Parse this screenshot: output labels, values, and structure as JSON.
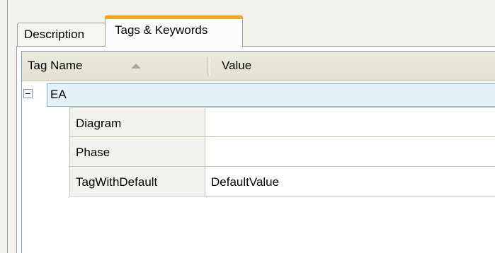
{
  "tabs": [
    {
      "label": "Description",
      "active": false
    },
    {
      "label": "Tags & Keywords",
      "active": true
    }
  ],
  "grid": {
    "columns": [
      "Tag Name",
      "Value"
    ],
    "sort_column": "Tag Name",
    "sort_direction": "ascending",
    "group": {
      "label": "EA",
      "expanded": true,
      "rows": [
        {
          "tag": "Diagram",
          "value": ""
        },
        {
          "tag": "Phase",
          "value": ""
        },
        {
          "tag": "TagWithDefault",
          "value": "DefaultValue"
        }
      ]
    }
  },
  "icons": {
    "expander": "minus-box-icon",
    "sort": "sort-ascending-arrow-icon"
  },
  "colors": {
    "active_tab_accent": "#f5a71e",
    "group_row_background": "#e3f1f9",
    "header_background": "#ebeadb"
  }
}
